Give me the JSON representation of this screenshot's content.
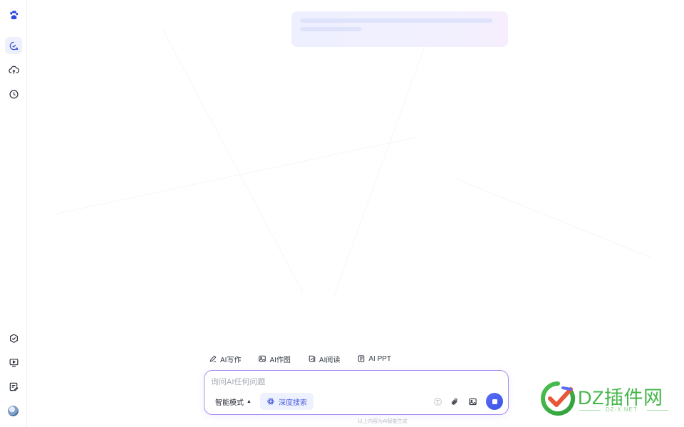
{
  "sidebar": {
    "items": [
      {
        "icon": "baidu-paw-icon"
      },
      {
        "icon": "new-chat-icon"
      },
      {
        "icon": "cloud-upload-icon"
      },
      {
        "icon": "history-clock-icon"
      },
      {
        "icon": "agent-cube-icon"
      },
      {
        "icon": "screen-play-icon"
      },
      {
        "icon": "note-edit-icon"
      },
      {
        "icon": "user-avatar"
      }
    ]
  },
  "quick_actions": [
    {
      "label": "AI写作",
      "icon": "pen-icon"
    },
    {
      "label": "AI作图",
      "icon": "image-icon"
    },
    {
      "label": "AI阅读",
      "icon": "book-icon"
    },
    {
      "label": "AI PPT",
      "icon": "ppt-icon"
    }
  ],
  "input": {
    "placeholder": "询问AI任何问题",
    "value": ""
  },
  "mode": {
    "label": "智能模式",
    "arrow": "▲"
  },
  "deep_search": {
    "label": "深度搜索",
    "icon": "atom-icon"
  },
  "tools": [
    {
      "icon": "translate-icon"
    },
    {
      "icon": "paperclip-icon"
    },
    {
      "icon": "picture-icon"
    }
  ],
  "footer": {
    "note": "以上内容为AI智能生成"
  },
  "watermark": {
    "title": "DZ插件网",
    "subtitle": "DZ-X.NET"
  },
  "colors": {
    "accent": "#4c5fe0",
    "input_border": "#a98cf4",
    "send_button": "#3a55e8",
    "watermark_green": "#45b64a"
  }
}
